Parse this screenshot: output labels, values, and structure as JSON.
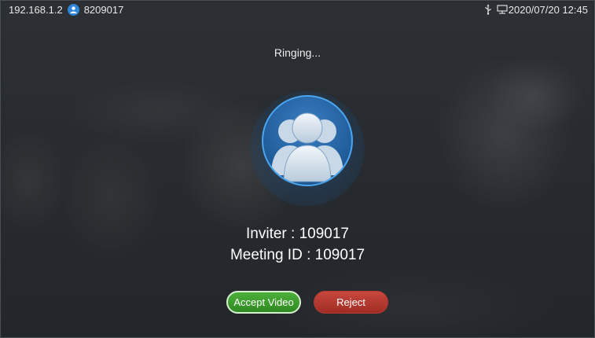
{
  "status_bar": {
    "ip_address": "192.168.1.2",
    "account_icon": "user-circle-icon",
    "account_number": "8209017",
    "usb_icon": "usb-icon",
    "network_icon": "network-icon",
    "datetime": "2020/07/20 12:45"
  },
  "call": {
    "status_text": "Ringing...",
    "avatar_icon": "group-avatar-icon",
    "inviter": "Inviter : 109017",
    "meeting_id": "Meeting ID : 109017"
  },
  "actions": {
    "accept_label": "Accept Video",
    "reject_label": "Reject"
  },
  "colors": {
    "accept": "#3a9a2c",
    "reject": "#b8392f",
    "avatar_ring": "#4aa6f0",
    "account_badge": "#2e86d9"
  }
}
